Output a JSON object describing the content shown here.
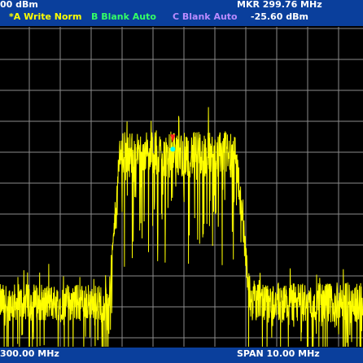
{
  "header": {
    "ref_level": "00 dBm",
    "marker_freq": "MKR 299.76 MHz",
    "marker_amp": "-25.60 dBm",
    "traces": [
      {
        "label": "*A Write Norm",
        "color": "#ffff00"
      },
      {
        "label": "B Blank Auto",
        "color": "#33ff66"
      },
      {
        "label": "C Blank Auto",
        "color": "#b98bff"
      }
    ]
  },
  "footer": {
    "center_freq": "300.00 MHz",
    "span": "SPAN 10.00 MHz"
  },
  "display": {
    "grid_divisions": {
      "x": 12,
      "y": 10
    },
    "trace_color": "#ffff00",
    "grid_color": "#8c8c8c",
    "marker_color": "#ff2020",
    "marker_shape": "triangle-down",
    "marker_readout_color": "#00ffff"
  },
  "chart_data": {
    "type": "line",
    "center_mhz": 300.0,
    "span_mhz": 10.0,
    "x_range_mhz": [
      295.0,
      305.0
    ],
    "y_range_div": [
      0,
      10
    ],
    "series": [
      {
        "segments": [
          {
            "x_mhz": [
              295.0,
              298.0
            ],
            "noise_floor_div": 1.2,
            "jitter_div": 1.2
          },
          {
            "x_mhz": [
              298.0,
              298.3
            ],
            "rise": true
          },
          {
            "x_mhz": [
              298.3,
              301.5
            ],
            "plateau_div": 6.0,
            "jitter_div": 1.5
          },
          {
            "x_mhz": [
              301.5,
              301.9
            ],
            "fall": true
          },
          {
            "x_mhz": [
              301.9,
              305.0
            ],
            "noise_floor_div": 1.2,
            "jitter_div": 1.3
          }
        ]
      }
    ],
    "marker": {
      "x_mhz": 299.76,
      "y_dbm": -25.6
    }
  }
}
